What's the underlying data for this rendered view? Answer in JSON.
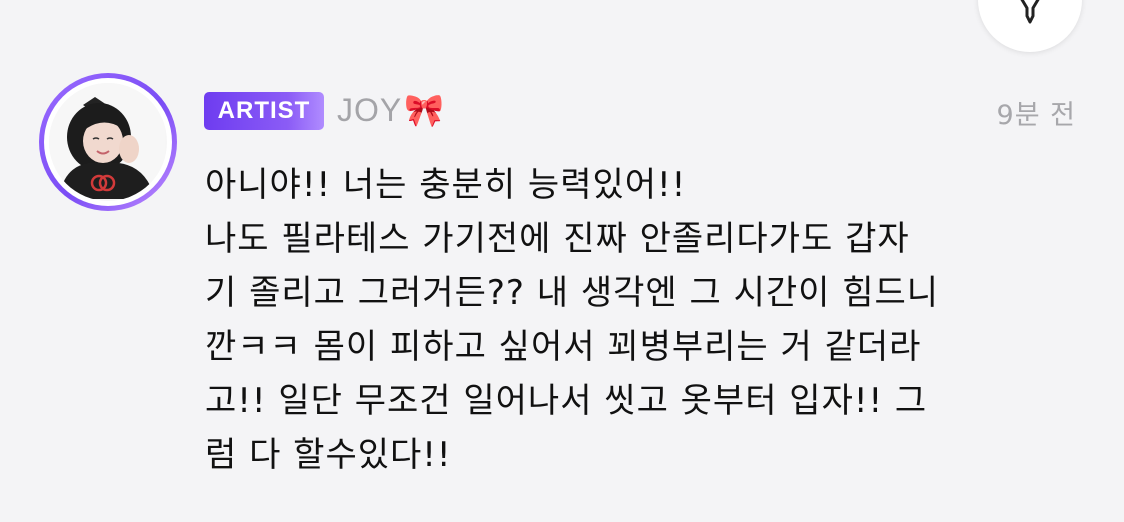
{
  "header": {
    "fab_icon": "pin-icon"
  },
  "comment": {
    "badge": "ARTIST",
    "author": "JOY",
    "author_emoji": "🎀",
    "time": "9분 전",
    "body": "아니야!! 너는 충분히 능력있어!!\n나도 필라테스 가기전에 진짜 안졸리다가도 갑자\n기 졸리고 그러거든?? 내 생각엔 그 시간이 힘드니\n깐ㅋㅋ 몸이 피하고 싶어서 꾀병부리는 거 같더라\n고!! 일단 무조건 일어나서 씻고 옷부터 입자!! 그\n럼 다 할수있다!!"
  },
  "colors": {
    "background": "#f4f4f6",
    "badge": "#7c4dff",
    "ring": "#8b5cf6",
    "meta_text": "#a4a4a8",
    "body_text": "#111111"
  }
}
